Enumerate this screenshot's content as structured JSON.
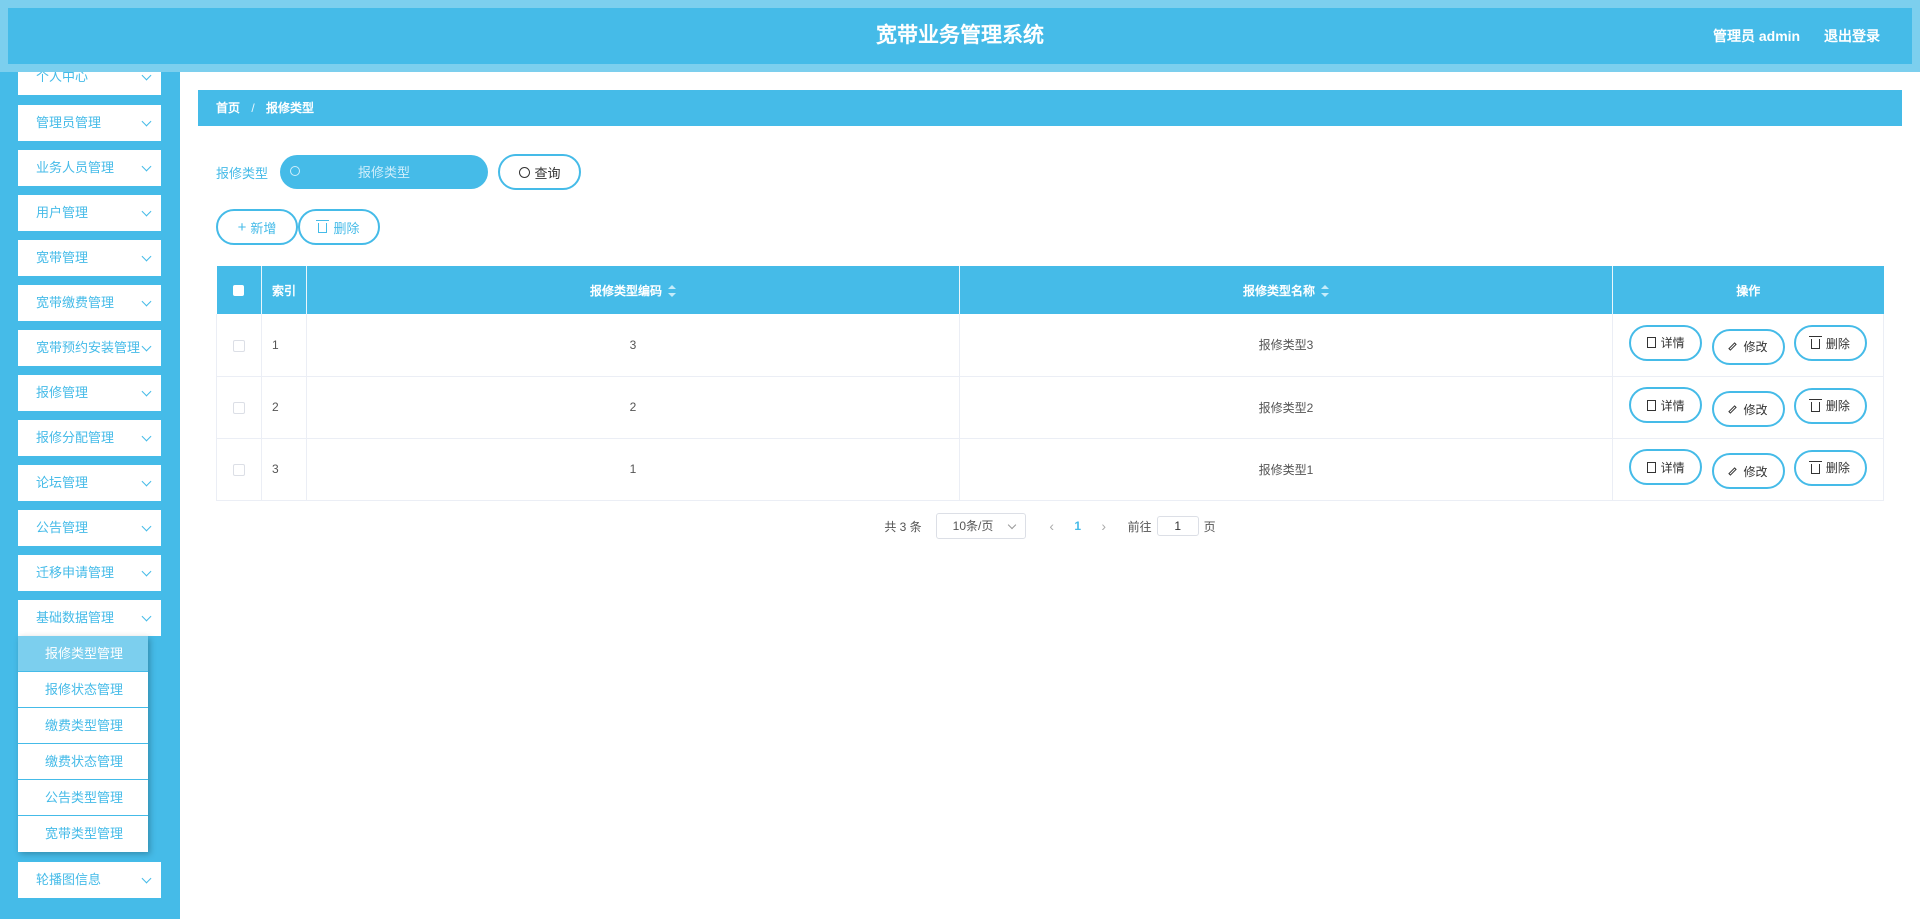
{
  "header": {
    "title": "宽带业务管理系统",
    "user": "管理员 admin",
    "logout": "退出登录"
  },
  "sidebar": {
    "items": [
      {
        "label": "个人中心"
      },
      {
        "label": "管理员管理"
      },
      {
        "label": "业务人员管理"
      },
      {
        "label": "用户管理"
      },
      {
        "label": "宽带管理"
      },
      {
        "label": "宽带缴费管理"
      },
      {
        "label": "宽带预约安装管理"
      },
      {
        "label": "报修管理"
      },
      {
        "label": "报修分配管理"
      },
      {
        "label": "论坛管理"
      },
      {
        "label": "公告管理"
      },
      {
        "label": "迁移申请管理"
      },
      {
        "label": "基础数据管理"
      },
      {
        "label": "轮播图信息"
      }
    ],
    "submenu": [
      {
        "label": "报修类型管理",
        "active": true
      },
      {
        "label": "报修状态管理"
      },
      {
        "label": "缴费类型管理"
      },
      {
        "label": "缴费状态管理"
      },
      {
        "label": "公告类型管理"
      },
      {
        "label": "宽带类型管理"
      }
    ]
  },
  "breadcrumb": {
    "home": "首页",
    "separator": "/",
    "current": "报修类型"
  },
  "search": {
    "label": "报修类型",
    "placeholder": "报修类型",
    "query_button": "查询"
  },
  "actions": {
    "add": "新增",
    "delete": "删除"
  },
  "table": {
    "headers": {
      "index": "索引",
      "code": "报修类型编码",
      "name": "报修类型名称",
      "ops": "操作"
    },
    "rows": [
      {
        "index": "1",
        "code": "3",
        "name": "报修类型3"
      },
      {
        "index": "2",
        "code": "2",
        "name": "报修类型2"
      },
      {
        "index": "3",
        "code": "1",
        "name": "报修类型1"
      }
    ],
    "op_labels": {
      "detail": "详情",
      "edit": "修改",
      "delete": "删除"
    }
  },
  "pagination": {
    "total": "共 3 条",
    "page_size": "10条/页",
    "current_page": "1",
    "goto_prefix": "前往",
    "goto_value": "1",
    "goto_suffix": "页"
  },
  "colors": {
    "accent": "#45bbe8",
    "header_outer": "#7ccfee"
  }
}
